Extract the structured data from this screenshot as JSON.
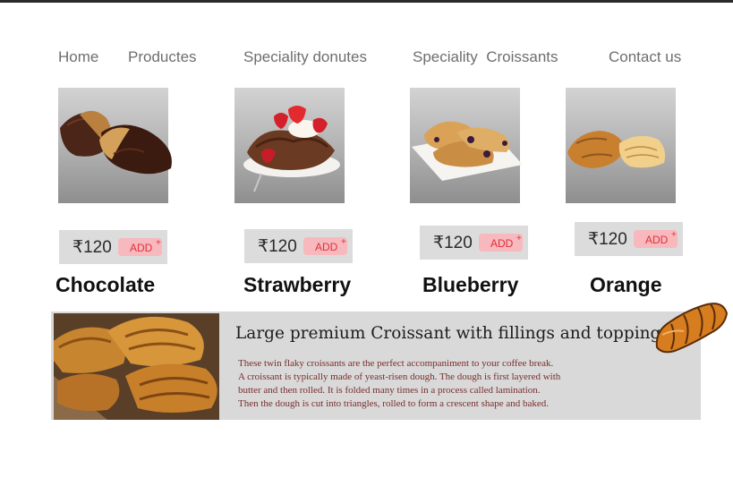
{
  "nav": {
    "items": [
      {
        "label": "Home"
      },
      {
        "label": "Productes"
      },
      {
        "label": "Speciality donutes"
      },
      {
        "label": "Speciality  Croissants"
      },
      {
        "label": "Contact us"
      }
    ]
  },
  "products": [
    {
      "name": "Chocolate",
      "price": "₹120",
      "add_label": "ADD",
      "add_plus": "+",
      "image_icon": "chocolate-croissant-icon"
    },
    {
      "name": "Strawberry",
      "price": "₹120",
      "add_label": "ADD",
      "add_plus": "+",
      "image_icon": "strawberry-croissant-icon"
    },
    {
      "name": "Blueberry",
      "price": "₹120",
      "add_label": "ADD",
      "add_plus": "+",
      "image_icon": "blueberry-croissant-icon"
    },
    {
      "name": "Orange",
      "price": "₹120",
      "add_label": "ADD",
      "add_plus": "+",
      "image_icon": "orange-croissant-icon"
    }
  ],
  "promo": {
    "title": "Large premium Croissant with fillings and toppings",
    "description_lines": [
      "These twin flaky croissants are the perfect accompaniment to your coffee break.",
      "A croissant is typically made of yeast-risen dough. The dough is first layered with",
      "butter and then rolled. It is folded many times in a process called lamination.",
      "Then the dough is cut into triangles, rolled to form a crescent shape and baked."
    ]
  },
  "colors": {
    "nav_text": "#6e6e6e",
    "price_box": "#dcdcdc",
    "add_button_bg": "#f7b9bd",
    "add_button_text": "#e0303a",
    "promo_bg": "#d9d9d9",
    "promo_text": "#7a2d2d"
  }
}
